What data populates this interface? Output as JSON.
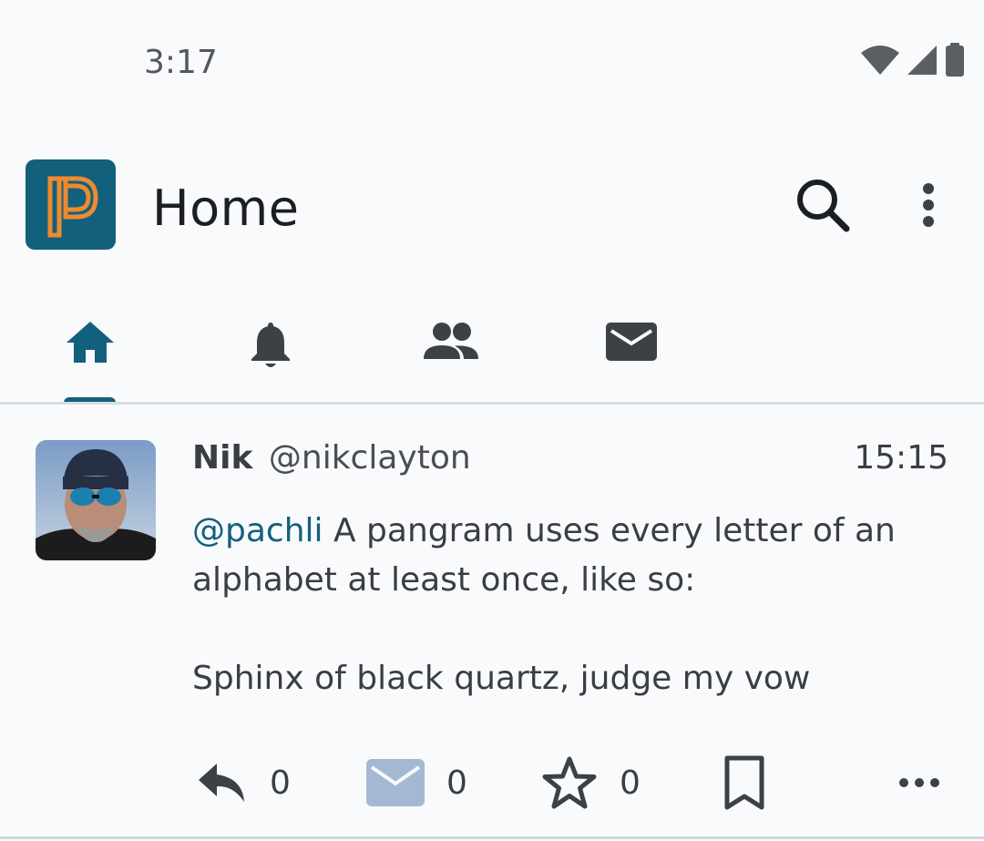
{
  "status_bar": {
    "time": "3:17",
    "icons": [
      "wifi-icon",
      "cell-signal-icon",
      "battery-icon"
    ]
  },
  "app_bar": {
    "title": "Home",
    "logo": "pachli-logo",
    "actions": [
      "search-icon",
      "more-vert-icon"
    ]
  },
  "tabs": [
    {
      "icon": "home-icon",
      "selected": true
    },
    {
      "icon": "bell-icon",
      "selected": false
    },
    {
      "icon": "people-icon",
      "selected": false
    },
    {
      "icon": "mail-icon",
      "selected": false
    }
  ],
  "post": {
    "display_name": "Nik",
    "username": "@nikclayton",
    "time": "15:15",
    "mention": "@pachli",
    "text_line1": " A pangram uses every letter of an alphabet at least once, like so:",
    "text_line2": "Sphinx of black quartz, judge my vow",
    "actions": {
      "reply_count": "0",
      "dm_count": "0",
      "favourite_count": "0"
    }
  },
  "colors": {
    "accent": "#13607c",
    "logo_mark": "#ef8a2f",
    "background": "#f9fafc",
    "icon": "#3c4146",
    "dm_icon": "#a4b8d4"
  }
}
